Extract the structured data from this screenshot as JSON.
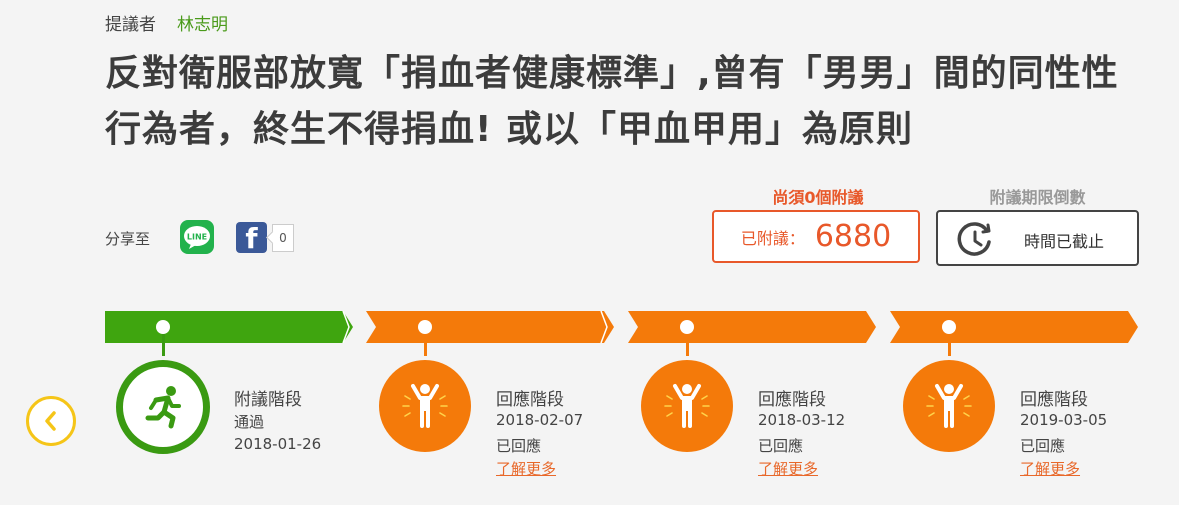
{
  "proposer": {
    "label": "提議者",
    "name": "林志明"
  },
  "title": "反對衛服部放寬「捐血者健康標準」,曾有「男男」間的同性性行為者，終生不得捐血! 或以「甲血甲用」為原則",
  "share": {
    "label": "分享至",
    "line_icon_text": "LINE",
    "fb_icon_text": "f",
    "fb_count": "0"
  },
  "signatures": {
    "need_label": "尚須0個附議",
    "prefix": "已附議：",
    "count": "6880"
  },
  "countdown": {
    "label": "附議期限倒數",
    "status": "時間已截止"
  },
  "colors": {
    "green": "#3a9a12",
    "orange": "#f47a0a",
    "accent": "#e8582a"
  },
  "stages": [
    {
      "icon": "running-person-icon",
      "title": "附議階段",
      "status": "通過",
      "date": "2018-01-26",
      "link": ""
    },
    {
      "icon": "cheering-person-icon",
      "title": "回應階段",
      "date": "2018-02-07",
      "status": "已回應",
      "link": "了解更多"
    },
    {
      "icon": "cheering-person-icon",
      "title": "回應階段",
      "date": "2018-03-12",
      "status": "已回應",
      "link": "了解更多"
    },
    {
      "icon": "cheering-person-icon",
      "title": "回應階段",
      "date": "2019-03-05",
      "status": "已回應",
      "link": "了解更多"
    }
  ]
}
